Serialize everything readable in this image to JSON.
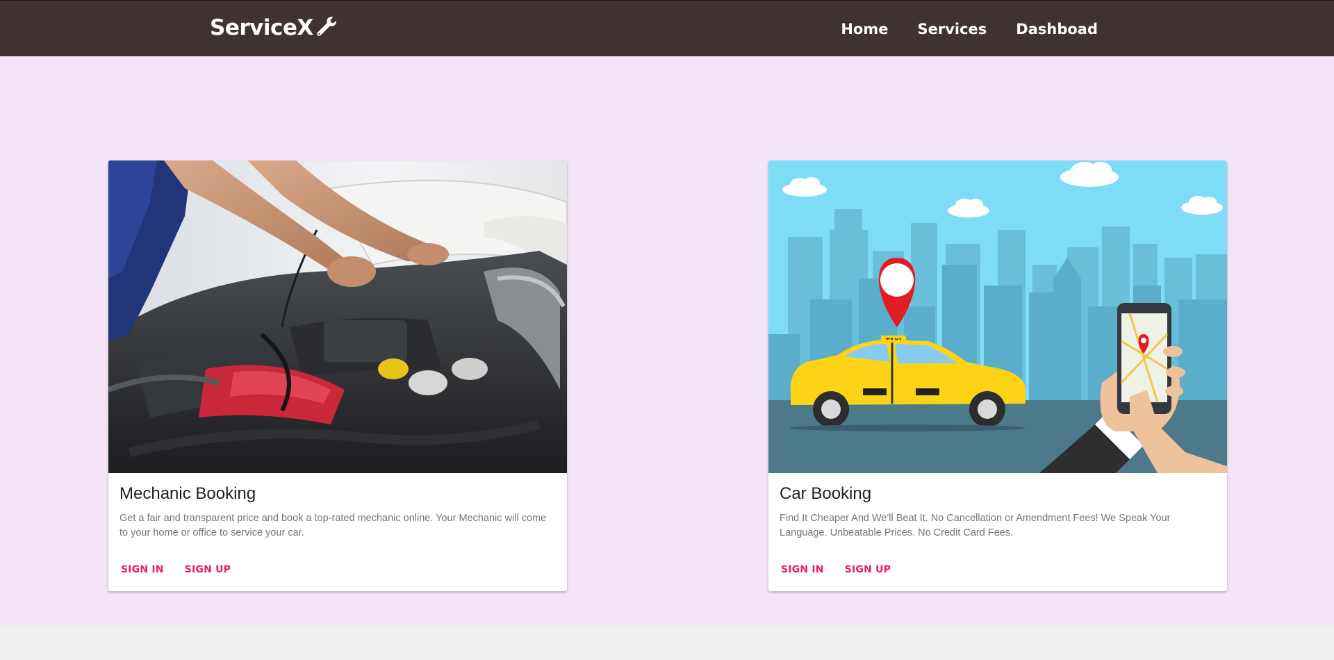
{
  "nav": {
    "brand": "ServiceX",
    "links": [
      "Home",
      "Services",
      "Dashboad"
    ]
  },
  "cards": [
    {
      "title": "Mechanic Booking",
      "description": "Get a fair and transparent price and book a top-rated mechanic online. Your Mechanic will come to your home or office to service your car.",
      "actions": [
        "SIGN IN",
        "SIGN UP"
      ]
    },
    {
      "title": "Car Booking",
      "description": "Find It Cheaper And We'll Beat It. No Cancellation or Amendment Fees! We Speak Your Language. Unbeatable Prices. No Credit Card Fees.",
      "actions": [
        "SIGN IN",
        "SIGN UP"
      ],
      "image_text": "TAXI"
    }
  ],
  "colors": {
    "navbar": "#3e3232",
    "background": "#f3e5f5",
    "accent": "#e91e63"
  }
}
